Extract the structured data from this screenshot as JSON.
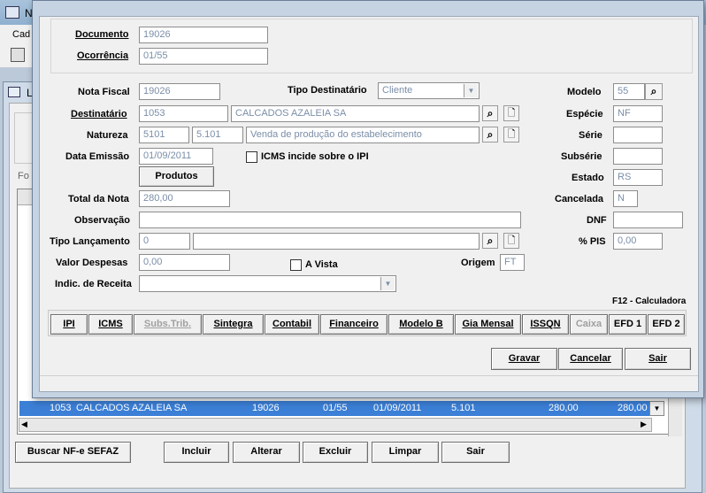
{
  "background": {
    "main_title_initial": "N",
    "menu_initial": "Cad",
    "list_window_initial": "L",
    "side_label": "Fo",
    "grid_row": [
      "1053",
      "CALCADOS AZALEIA SA",
      "19026",
      "01/55",
      "01/09/2011",
      "5.101",
      "280,00",
      "280,00"
    ],
    "bottom_buttons": [
      "Buscar NF-e SEFAZ",
      "Incluir",
      "Alterar",
      "Excluir",
      "Limpar",
      "Sair"
    ]
  },
  "dialog": {
    "documento_label": "Documento",
    "documento_value": "19026",
    "ocorrencia_label": "Ocorrência",
    "ocorrencia_value": "01/55",
    "nota_fiscal_label": "Nota Fiscal",
    "nota_fiscal_value": "19026",
    "tipo_destinatario_label": "Tipo Destinatário",
    "tipo_destinatario_value": "Cliente",
    "modelo_label": "Modelo",
    "modelo_value": "55",
    "destinatario_label": "Destinatário",
    "destinatario_code": "1053",
    "destinatario_name": "CALCADOS AZALEIA SA",
    "especie_label": "Espécie",
    "especie_value": "NF",
    "natureza_label": "Natureza",
    "natureza_code": "5101",
    "natureza_cfop": "5.101",
    "natureza_desc": "Venda de produção do estabelecimento",
    "serie_label": "Série",
    "serie_value": "",
    "data_emissao_label": "Data Emissão",
    "data_emissao_value": "01/09/2011",
    "icms_label": "ICMS incide sobre o IPI",
    "subserie_label": "Subsérie",
    "subserie_value": "",
    "produtos_button": "Produtos",
    "estado_label": "Estado",
    "estado_value": "RS",
    "total_label": "Total da Nota",
    "total_value": "280,00",
    "cancelada_label": "Cancelada",
    "cancelada_value": "N",
    "observacao_label": "Observação",
    "observacao_value": "",
    "dnf_label": "DNF",
    "dnf_value": "",
    "tipo_lanc_label": "Tipo Lançamento",
    "tipo_lanc_code": "0",
    "tipo_lanc_desc": "",
    "pis_label": "% PIS",
    "pis_value": "0,00",
    "valor_despesas_label": "Valor Despesas",
    "valor_despesas_value": "0,00",
    "a_vista_label": "A Vista",
    "origem_label": "Origem",
    "origem_value": "FT",
    "indic_receita_label": "Indic. de Receita",
    "indic_receita_value": "",
    "calculadora_hint": "F12 - Calculadora",
    "tabs": [
      "IPI",
      "ICMS",
      "Subs.Trib.",
      "Sintegra",
      "Contabil",
      "Financeiro",
      "Modelo B",
      "Gia Mensal",
      "ISSQN",
      "Caixa",
      "EFD 1",
      "EFD 2"
    ],
    "gravar": "Gravar",
    "cancelar": "Cancelar",
    "sair": "Sair"
  }
}
